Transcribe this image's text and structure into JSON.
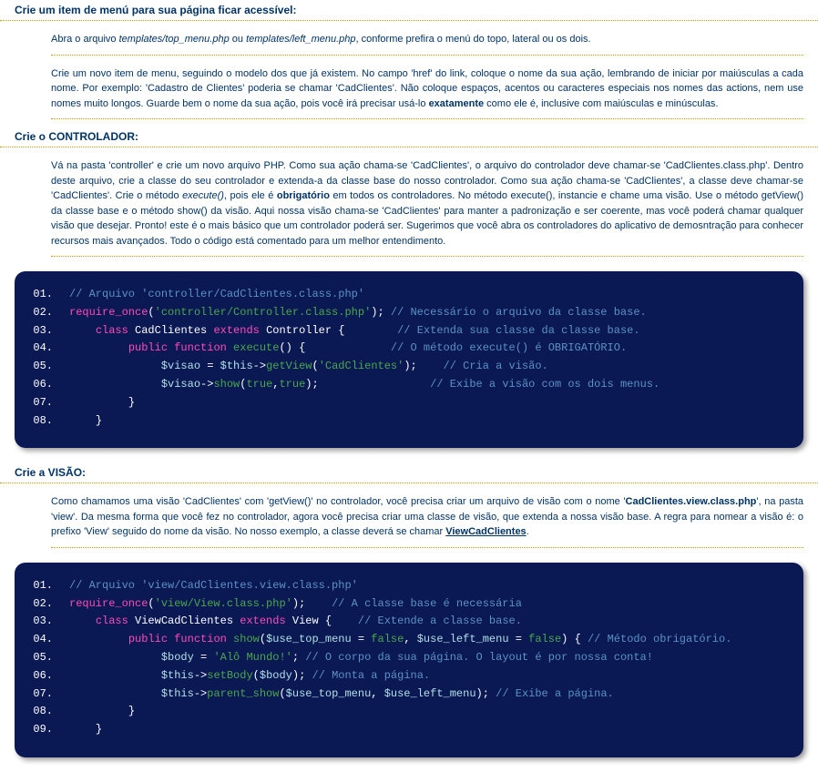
{
  "section1": {
    "title": "Crie um item de menú para sua página ficar acessível:",
    "para1": {
      "prefix": "Abra o arquivo ",
      "em1": "templates/top_menu.php",
      "mid": " ou ",
      "em2": "templates/left_menu.php",
      "suffix": ", conforme prefira o menú do topo, lateral ou os dois."
    },
    "para2": {
      "text1": "Crie um novo item de menu, seguindo o modelo dos que já existem. No campo 'href' do link, coloque o nome da sua ação, lembrando de iniciar por maiúsculas a cada nome. Por exemplo: 'Cadastro de Clientes' poderia se chamar 'CadClientes'. Não coloque espaços, acentos ou caracteres especiais nos nomes das actions, nem use nomes muito longos. Guarde bem o nome da sua ação, pois você irá precisar usá-lo ",
      "bold": "exatamente",
      "text2": " como ele é, inclusive com maiúsculas e minúsculas."
    }
  },
  "section2": {
    "title": "Crie o CONTROLADOR:",
    "para1": {
      "text1": "Vá na pasta 'controller' e crie um novo arquivo PHP. Como sua ação chama-se 'CadClientes', o arquivo do controlador deve chamar-se 'CadClientes.class.php'. Dentro deste arquivo, crie a classe do seu controlador e extenda-a da classe base do nosso controlador. Como sua ação chama-se 'CadClientes', a classe deve chamar-se 'CadClientes'. Crie o método ",
      "em1": "execute()",
      "text2": ", pois ele é ",
      "bold": "obrigatório",
      "text3": " em todos os controladores. No método execute(), instancie e chame uma visão. Use o método getView() da classe base e o método show() da visão. Aqui nossa visão chama-se 'CadClientes' para manter a padronização e ser coerente, mas você poderá chamar qualquer visão que desejar. Pronto! este é o mais básico que um controlador poderá ser. Sugerimos que você abra os controladores do aplicativo de demosntração para conhecer recursos mais avançados. Todo o código está comentado para um melhor entendimento."
    }
  },
  "code1": {
    "l1_cmt": "// Arquivo 'controller/CadClientes.class.php'",
    "l2_kw": "require_once",
    "l2_op1": "(",
    "l2_str": "'controller/Controller.class.php'",
    "l2_op2": ");",
    "l2_cmt": " // Necessário o arquivo da classe base.",
    "l3_sp": "    ",
    "l3_kw1": "class",
    "l3_plain1": " CadClientes ",
    "l3_kw2": "extends",
    "l3_plain2": " Controller ",
    "l3_op": "{",
    "l3_sp2": "        ",
    "l3_cmt": "// Extenda sua classe da classe base.",
    "l4_sp": "         ",
    "l4_kw1": "public",
    "l4_sp2": " ",
    "l4_kw2": "function",
    "l4_sp3": " ",
    "l4_fn": "execute",
    "l4_op1": "()",
    "l4_sp4": " ",
    "l4_op2": "{",
    "l4_sp5": "             ",
    "l4_cmt": "// O método execute() é OBRIGATÓRIO.",
    "l5_sp": "              ",
    "l5_var": "$visao",
    "l5_sp2": " ",
    "l5_op1": "=",
    "l5_sp3": " ",
    "l5_var2": "$this",
    "l5_op2": "->",
    "l5_fn": "getView",
    "l5_op3": "(",
    "l5_str": "'CadClientes'",
    "l5_op4": ");",
    "l5_sp4": "    ",
    "l5_cmt": "// Cria a visão.",
    "l6_sp": "              ",
    "l6_var": "$visao",
    "l6_op1": "->",
    "l6_fn": "show",
    "l6_op2": "(",
    "l6_b1": "true",
    "l6_op3": ",",
    "l6_b2": "true",
    "l6_op4": ");",
    "l6_sp2": "                 ",
    "l6_cmt": "// Exibe a visão com os dois menus.",
    "l7_sp": "         ",
    "l7_op": "}",
    "l8_sp": "    ",
    "l8_op": "}"
  },
  "section3": {
    "title": "Crie a VISÃO:",
    "para1": {
      "text1": "Como chamamos uma visão 'CadClientes' com 'getView()' no controlador, você precisa criar um arquivo de visão com o nome '",
      "bold1": "CadClientes.view.class.php",
      "text2": "', na pasta 'view'. Da mesma forma que você fez no controlador, agora você precisa criar uma classe de visão, que extenda a nossa visão base. A regra para nomear a visão é: o prefixo 'View' seguido do nome da visão. No nosso exemplo, a classe deverá se chamar ",
      "link": "ViewCadClientes",
      "text3": "."
    }
  },
  "code2": {
    "l1_cmt": "// Arquivo 'view/CadClientes.view.class.php'",
    "l2_kw": "require_once",
    "l2_op1": "(",
    "l2_str": "'view/View.class.php'",
    "l2_op2": ");",
    "l2_sp": "    ",
    "l2_cmt": "// A classe base é necessária",
    "l3_sp": "    ",
    "l3_kw1": "class",
    "l3_plain1": " ViewCadClientes ",
    "l3_kw2": "extends",
    "l3_plain2": " View ",
    "l3_op": "{",
    "l3_sp2": "    ",
    "l3_cmt": "// Extende a classe base.",
    "l4_sp": "         ",
    "l4_kw1": "public",
    "l4_sp2": " ",
    "l4_kw2": "function",
    "l4_sp3": " ",
    "l4_fn": "show",
    "l4_op1": "(",
    "l4_var1": "$use_top_menu",
    "l4_sp4": " ",
    "l4_op2": "=",
    "l4_sp5": " ",
    "l4_b1": "false",
    "l4_op3": ",",
    "l4_sp6": " ",
    "l4_var2": "$use_left_menu",
    "l4_sp7": " ",
    "l4_op4": "=",
    "l4_sp8": " ",
    "l4_b2": "false",
    "l4_op5": ")",
    "l4_sp9": " ",
    "l4_op6": "{",
    "l4_sp10": " ",
    "l4_cmt": "// Método obrigatório.",
    "l5_sp": "              ",
    "l5_var": "$body",
    "l5_sp2": " ",
    "l5_op1": "=",
    "l5_sp3": " ",
    "l5_str": "'Alô Mundo!'",
    "l5_op2": ";",
    "l5_sp4": " ",
    "l5_cmt": "// O corpo da sua página. O layout é por nossa conta!",
    "l6_sp": "              ",
    "l6_var": "$this",
    "l6_op1": "->",
    "l6_fn": "setBody",
    "l6_op2": "(",
    "l6_var2": "$body",
    "l6_op3": ");",
    "l6_sp2": " ",
    "l6_cmt": "// Monta a página.",
    "l7_sp": "              ",
    "l7_var": "$this",
    "l7_op1": "->",
    "l7_fn": "parent_show",
    "l7_op2": "(",
    "l7_var2": "$use_top_menu",
    "l7_op3": ",",
    "l7_sp2": " ",
    "l7_var3": "$use_left_menu",
    "l7_op4": ");",
    "l7_sp3": " ",
    "l7_cmt": "// Exibe a página.",
    "l8_sp": "         ",
    "l8_op": "}",
    "l9_sp": "    ",
    "l9_op": "}"
  },
  "linenums": {
    "n01": "01.",
    "n02": "02.",
    "n03": "03.",
    "n04": "04.",
    "n05": "05.",
    "n06": "06.",
    "n07": "07.",
    "n08": "08.",
    "n09": "09."
  }
}
